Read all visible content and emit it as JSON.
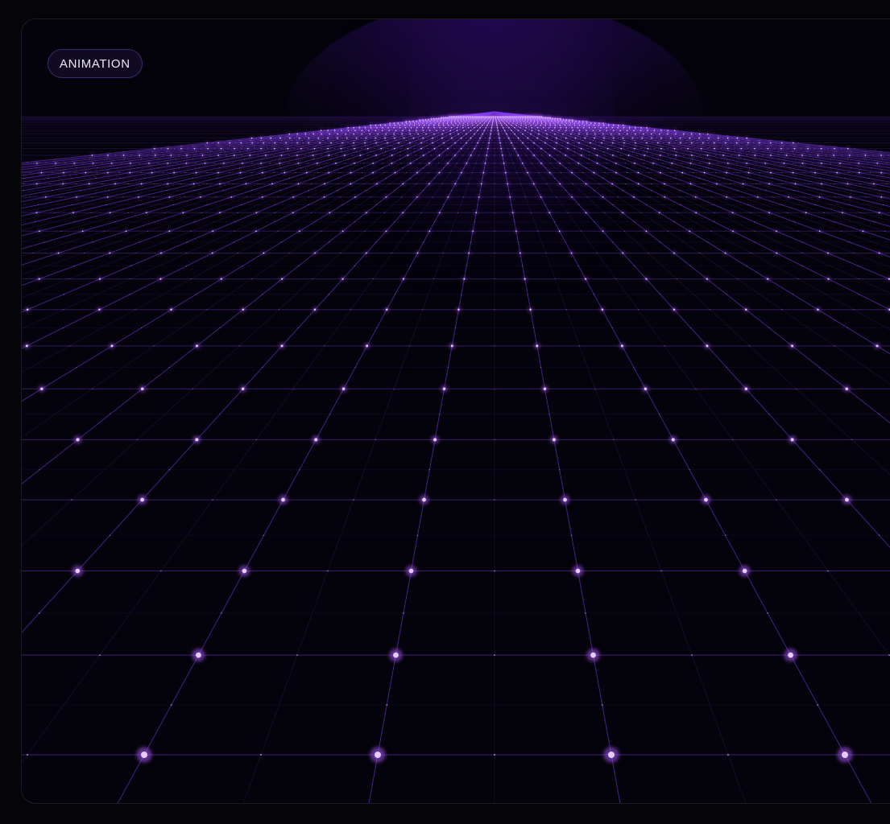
{
  "badge": {
    "label": "ANIMATION"
  },
  "colors": {
    "page_background": "#050409",
    "card_background": "#04030b",
    "card_border": "#1c1a27",
    "line": "#7c3aed",
    "node": "#e9d5ff",
    "node_glow": "#a855f7",
    "horizon_glow": "#3b0f8a"
  }
}
